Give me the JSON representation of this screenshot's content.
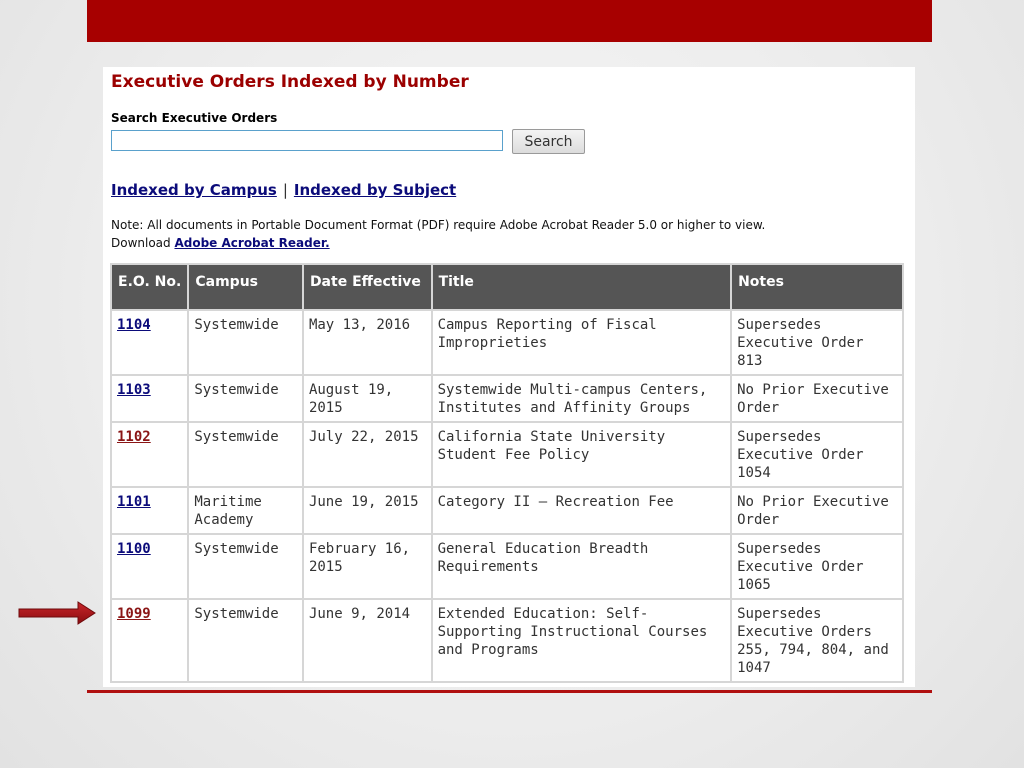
{
  "page_title": "Executive Orders Indexed by Number",
  "search": {
    "label": "Search Executive Orders",
    "value": "",
    "placeholder": "",
    "button_label": "Search"
  },
  "index_links": {
    "campus": "Indexed by Campus",
    "separator": "|",
    "subject": "Indexed by Subject"
  },
  "note": {
    "line1": "Note: All documents in Portable Document Format (PDF) require Adobe Acrobat Reader 5.0 or higher to view.",
    "line2_prefix": "Download ",
    "line2_link": "Adobe Acrobat Reader."
  },
  "table": {
    "headers": [
      "E.O. No.",
      "Campus",
      "Date Effective",
      "Title",
      "Notes"
    ],
    "rows": [
      {
        "eo": "1104",
        "campus": "Systemwide",
        "date": "May 13, 2016",
        "title": "Campus Reporting of Fiscal Improprieties",
        "notes": "Supersedes Executive Order 813"
      },
      {
        "eo": "1103",
        "campus": "Systemwide",
        "date": "August 19, 2015",
        "title": "Systemwide Multi-campus Centers, Institutes and Affinity Groups",
        "notes": "No Prior Executive Order"
      },
      {
        "eo": "1102",
        "campus": "Systemwide",
        "date": "July 22, 2015",
        "title": "California State University Student Fee Policy",
        "notes": "Supersedes Executive Order 1054"
      },
      {
        "eo": "1101",
        "campus": "Maritime Academy",
        "date": "June 19, 2015",
        "title": "Category II – Recreation Fee",
        "notes": "No Prior Executive Order"
      },
      {
        "eo": "1100",
        "campus": "Systemwide",
        "date": "February 16, 2015",
        "title": "General Education Breadth Requirements",
        "notes": "Supersedes Executive Order 1065"
      },
      {
        "eo": "1099",
        "campus": "Systemwide",
        "date": "June 9, 2014",
        "title": "Extended Education: Self-Supporting Instructional Courses and Programs",
        "notes": "Supersedes Executive Orders 255, 794, 804, and 1047"
      }
    ]
  },
  "colors": {
    "accent_red": "#a70000",
    "header_gray": "#555555",
    "link_blue": "#0b0b7a",
    "visited_link": "#8a1515"
  },
  "arrow": {
    "icon": "right-arrow-icon"
  }
}
